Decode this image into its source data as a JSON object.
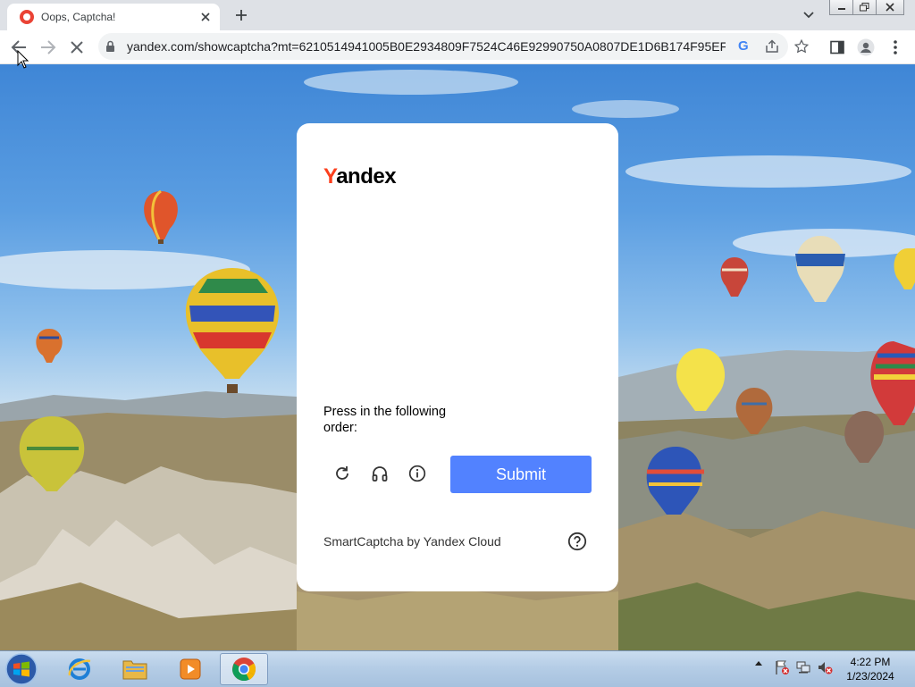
{
  "browser": {
    "tab_title": "Oops, Captcha!",
    "url": "yandex.com/showcaptcha?mt=6210514941005B0E2934809F7524C46E92990750A0807DE1D6B174F95EF2A...",
    "google_lens_label": "G"
  },
  "captcha": {
    "logo_first_letter": "Y",
    "logo_rest": "andex",
    "instruction": "Press in the following order:",
    "submit_label": "Submit",
    "footer": "SmartCaptcha by Yandex Cloud",
    "icons": [
      "refresh-icon",
      "headphones-icon",
      "info-icon",
      "help-icon"
    ]
  },
  "taskbar": {
    "apps": [
      "internet-explorer-icon",
      "file-explorer-icon",
      "media-player-icon",
      "chrome-icon"
    ],
    "time": "4:22 PM",
    "date": "1/23/2024"
  },
  "colors": {
    "submit": "#5282ff",
    "yandex_red": "#fc3f1d",
    "tab_bar": "#dee1e6"
  }
}
